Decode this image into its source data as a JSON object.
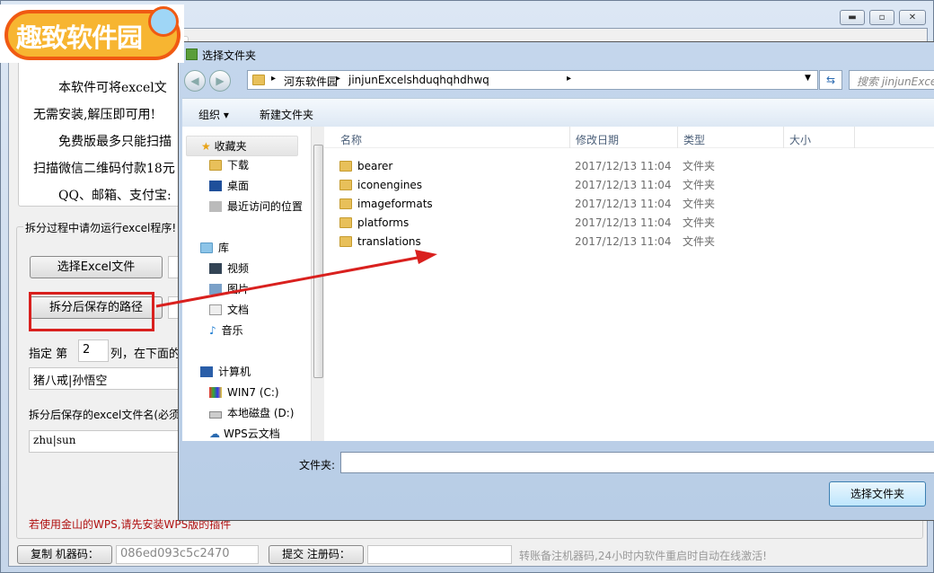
{
  "logo": {
    "text": "趣致软件园"
  },
  "window": {
    "controls": [
      "minimize",
      "maximize",
      "close"
    ]
  },
  "intro": {
    "lines": [
      "本软件可将excel文",
      "无需安装,解压即可用!",
      "免费版最多只能扫描",
      "扫描微信二维码付款18元",
      "QQ、邮箱、支付宝:"
    ]
  },
  "group": {
    "title": "拆分过程中请勿运行excel程序!"
  },
  "select_excel_button": "选择Excel文件",
  "save_path_button": "拆分后保存的路径",
  "column": {
    "prefix": "指定 第",
    "value": "2",
    "suffix": "列，在下面的"
  },
  "names_input": "猪八戒|孙悟空",
  "filename_label": "拆分后保存的excel文件名(必须",
  "filename_input": "zhu|sun",
  "wps_note": "若使用金山的WPS,请先安装WPS版的插件",
  "footer": {
    "copy_button": "复制 机器码：",
    "machine_code": "086ed093c5c2470",
    "submit_button": "提交 注册码：",
    "reg_code": "",
    "note": "转账备注机器码,24小时内软件重启时自动在线激活!"
  },
  "dialog": {
    "title": "选择文件夹",
    "breadcrumb": [
      "河东软件园",
      "jinjunExcelshduqhqhdhwq"
    ],
    "search_placeholder": "搜索 jinjunExcelshduqhqhdhwq",
    "toolbar": {
      "organize": "组织",
      "new_folder": "新建文件夹"
    },
    "columns": [
      "名称",
      "修改日期",
      "类型",
      "大小"
    ],
    "files": [
      {
        "name": "bearer",
        "date": "2017/12/13 11:04",
        "type": "文件夹"
      },
      {
        "name": "iconengines",
        "date": "2017/12/13 11:04",
        "type": "文件夹"
      },
      {
        "name": "imageformats",
        "date": "2017/12/13 11:04",
        "type": "文件夹"
      },
      {
        "name": "platforms",
        "date": "2017/12/13 11:04",
        "type": "文件夹"
      },
      {
        "name": "translations",
        "date": "2017/12/13 11:04",
        "type": "文件夹"
      }
    ],
    "sidebar": {
      "favorites": "收藏夹",
      "fav_items": [
        "下载",
        "桌面",
        "最近访问的位置"
      ],
      "libraries": "库",
      "lib_items": [
        "视频",
        "图片",
        "文档",
        "音乐"
      ],
      "computer": "计算机",
      "comp_items": [
        "WIN7 (C:)",
        "本地磁盘 (D:)",
        "WPS云文档"
      ]
    },
    "folder_label": "文件夹:",
    "folder_value": "",
    "select_button": "选择文件夹"
  },
  "colors": {
    "annotation": "#d9201e",
    "note_red": "#b01010"
  }
}
